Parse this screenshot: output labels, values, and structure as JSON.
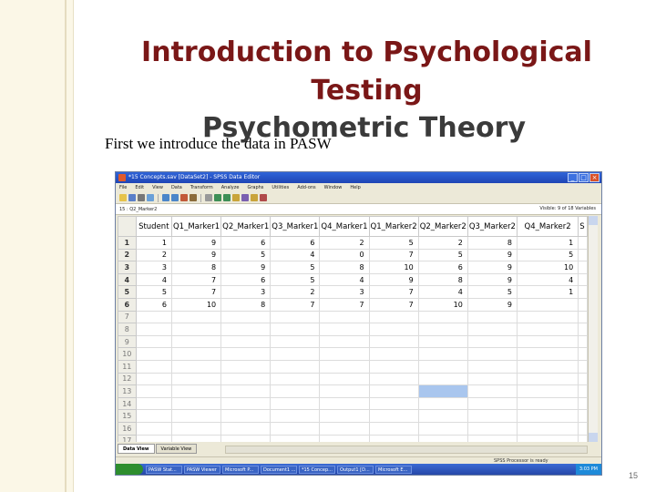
{
  "slide": {
    "title_line1": "Introduction to Psychological",
    "title_line2": "Testing",
    "subtitle": "Psychometric Theory",
    "caption": "First we introduce the data in PASW",
    "page_number": "15"
  },
  "spss": {
    "window_title": "*15 Concepts.sav [DataSet2] - SPSS Data Editor",
    "menu": [
      "File",
      "Edit",
      "View",
      "Data",
      "Transform",
      "Analyze",
      "Graphs",
      "Utilities",
      "Add-ons",
      "Window",
      "Help"
    ],
    "cell_ref": "15 : Q2_Marker2",
    "visible_label": "Visible: 9 of 18 Variables",
    "columns": [
      "Student",
      "Q1_Marker1",
      "Q2_Marker1",
      "Q3_Marker1",
      "Q4_Marker1",
      "Q1_Marker2",
      "Q2_Marker2",
      "Q3_Marker2",
      "Q4_Marker2",
      "S"
    ],
    "row_numbers": [
      "1",
      "2",
      "3",
      "4",
      "5",
      "6",
      "7",
      "8",
      "9",
      "10",
      "11",
      "12",
      "13",
      "14",
      "15",
      "16",
      "17"
    ],
    "rows": [
      [
        "1",
        "9",
        "6",
        "6",
        "2",
        "5",
        "2",
        "8",
        "1"
      ],
      [
        "2",
        "9",
        "5",
        "4",
        "0",
        "7",
        "5",
        "9",
        "5"
      ],
      [
        "3",
        "8",
        "9",
        "5",
        "8",
        "10",
        "6",
        "9",
        "10"
      ],
      [
        "4",
        "7",
        "6",
        "5",
        "4",
        "9",
        "8",
        "9",
        "4"
      ],
      [
        "5",
        "7",
        "3",
        "2",
        "3",
        "7",
        "4",
        "5",
        "1"
      ],
      [
        "6",
        "10",
        "8",
        "7",
        "7",
        "7",
        "10",
        "9"
      ]
    ],
    "tabs": [
      "Data View",
      "Variable View"
    ],
    "status_text": "SPSS Processor is ready",
    "taskbar_items": [
      "PASW Stat...",
      "PASW Viewer",
      "Microsoft P...",
      "Document1 ...",
      "*15 Concep...",
      "Output1 [D...",
      "Microsoft E..."
    ],
    "clock": "3:03 PM"
  }
}
